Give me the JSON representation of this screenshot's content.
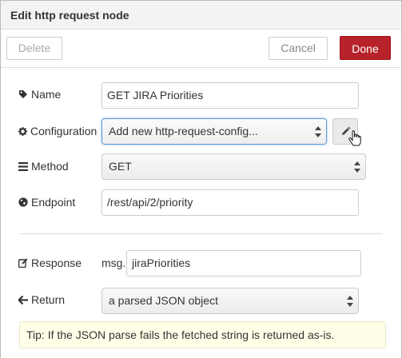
{
  "dialog": {
    "title": "Edit http request node"
  },
  "buttons": {
    "delete": "Delete",
    "cancel": "Cancel",
    "done": "Done"
  },
  "fields": {
    "name": {
      "label": "Name",
      "value": "GET JIRA Priorities"
    },
    "configuration": {
      "label": "Configuration",
      "value": "Add new http-request-config..."
    },
    "method": {
      "label": "Method",
      "value": "GET"
    },
    "endpoint": {
      "label": "Endpoint",
      "value": "/rest/api/2/priority"
    },
    "response": {
      "label": "Response",
      "prefix": "msg.",
      "value": "jiraPriorities"
    },
    "return": {
      "label": "Return",
      "value": "a parsed JSON object"
    }
  },
  "tip": "Tip: If the JSON parse fails the fetched string is returned as-is.",
  "colors": {
    "done_button": "#b8232b",
    "tip_background": "#ffffe8"
  },
  "icons": {
    "name": "tag-icon",
    "configuration": "cog-icon",
    "method": "list-icon",
    "endpoint": "globe-icon",
    "response": "edit-icon",
    "return": "arrow-left-icon",
    "config_edit": "pencil-icon"
  }
}
